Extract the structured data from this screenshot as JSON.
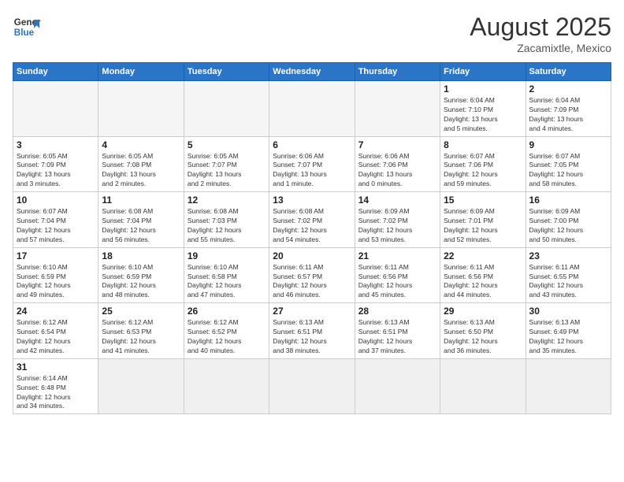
{
  "header": {
    "logo_general": "General",
    "logo_blue": "Blue",
    "month_year": "August 2025",
    "location": "Zacamixtle, Mexico"
  },
  "weekdays": [
    "Sunday",
    "Monday",
    "Tuesday",
    "Wednesday",
    "Thursday",
    "Friday",
    "Saturday"
  ],
  "weeks": [
    [
      {
        "day": "",
        "info": ""
      },
      {
        "day": "",
        "info": ""
      },
      {
        "day": "",
        "info": ""
      },
      {
        "day": "",
        "info": ""
      },
      {
        "day": "",
        "info": ""
      },
      {
        "day": "1",
        "info": "Sunrise: 6:04 AM\nSunset: 7:10 PM\nDaylight: 13 hours\nand 5 minutes."
      },
      {
        "day": "2",
        "info": "Sunrise: 6:04 AM\nSunset: 7:09 PM\nDaylight: 13 hours\nand 4 minutes."
      }
    ],
    [
      {
        "day": "3",
        "info": "Sunrise: 6:05 AM\nSunset: 7:09 PM\nDaylight: 13 hours\nand 3 minutes."
      },
      {
        "day": "4",
        "info": "Sunrise: 6:05 AM\nSunset: 7:08 PM\nDaylight: 13 hours\nand 2 minutes."
      },
      {
        "day": "5",
        "info": "Sunrise: 6:05 AM\nSunset: 7:07 PM\nDaylight: 13 hours\nand 2 minutes."
      },
      {
        "day": "6",
        "info": "Sunrise: 6:06 AM\nSunset: 7:07 PM\nDaylight: 13 hours\nand 1 minute."
      },
      {
        "day": "7",
        "info": "Sunrise: 6:06 AM\nSunset: 7:06 PM\nDaylight: 13 hours\nand 0 minutes."
      },
      {
        "day": "8",
        "info": "Sunrise: 6:07 AM\nSunset: 7:06 PM\nDaylight: 12 hours\nand 59 minutes."
      },
      {
        "day": "9",
        "info": "Sunrise: 6:07 AM\nSunset: 7:05 PM\nDaylight: 12 hours\nand 58 minutes."
      }
    ],
    [
      {
        "day": "10",
        "info": "Sunrise: 6:07 AM\nSunset: 7:04 PM\nDaylight: 12 hours\nand 57 minutes."
      },
      {
        "day": "11",
        "info": "Sunrise: 6:08 AM\nSunset: 7:04 PM\nDaylight: 12 hours\nand 56 minutes."
      },
      {
        "day": "12",
        "info": "Sunrise: 6:08 AM\nSunset: 7:03 PM\nDaylight: 12 hours\nand 55 minutes."
      },
      {
        "day": "13",
        "info": "Sunrise: 6:08 AM\nSunset: 7:02 PM\nDaylight: 12 hours\nand 54 minutes."
      },
      {
        "day": "14",
        "info": "Sunrise: 6:09 AM\nSunset: 7:02 PM\nDaylight: 12 hours\nand 53 minutes."
      },
      {
        "day": "15",
        "info": "Sunrise: 6:09 AM\nSunset: 7:01 PM\nDaylight: 12 hours\nand 52 minutes."
      },
      {
        "day": "16",
        "info": "Sunrise: 6:09 AM\nSunset: 7:00 PM\nDaylight: 12 hours\nand 50 minutes."
      }
    ],
    [
      {
        "day": "17",
        "info": "Sunrise: 6:10 AM\nSunset: 6:59 PM\nDaylight: 12 hours\nand 49 minutes."
      },
      {
        "day": "18",
        "info": "Sunrise: 6:10 AM\nSunset: 6:59 PM\nDaylight: 12 hours\nand 48 minutes."
      },
      {
        "day": "19",
        "info": "Sunrise: 6:10 AM\nSunset: 6:58 PM\nDaylight: 12 hours\nand 47 minutes."
      },
      {
        "day": "20",
        "info": "Sunrise: 6:11 AM\nSunset: 6:57 PM\nDaylight: 12 hours\nand 46 minutes."
      },
      {
        "day": "21",
        "info": "Sunrise: 6:11 AM\nSunset: 6:56 PM\nDaylight: 12 hours\nand 45 minutes."
      },
      {
        "day": "22",
        "info": "Sunrise: 6:11 AM\nSunset: 6:56 PM\nDaylight: 12 hours\nand 44 minutes."
      },
      {
        "day": "23",
        "info": "Sunrise: 6:11 AM\nSunset: 6:55 PM\nDaylight: 12 hours\nand 43 minutes."
      }
    ],
    [
      {
        "day": "24",
        "info": "Sunrise: 6:12 AM\nSunset: 6:54 PM\nDaylight: 12 hours\nand 42 minutes."
      },
      {
        "day": "25",
        "info": "Sunrise: 6:12 AM\nSunset: 6:53 PM\nDaylight: 12 hours\nand 41 minutes."
      },
      {
        "day": "26",
        "info": "Sunrise: 6:12 AM\nSunset: 6:52 PM\nDaylight: 12 hours\nand 40 minutes."
      },
      {
        "day": "27",
        "info": "Sunrise: 6:13 AM\nSunset: 6:51 PM\nDaylight: 12 hours\nand 38 minutes."
      },
      {
        "day": "28",
        "info": "Sunrise: 6:13 AM\nSunset: 6:51 PM\nDaylight: 12 hours\nand 37 minutes."
      },
      {
        "day": "29",
        "info": "Sunrise: 6:13 AM\nSunset: 6:50 PM\nDaylight: 12 hours\nand 36 minutes."
      },
      {
        "day": "30",
        "info": "Sunrise: 6:13 AM\nSunset: 6:49 PM\nDaylight: 12 hours\nand 35 minutes."
      }
    ],
    [
      {
        "day": "31",
        "info": "Sunrise: 6:14 AM\nSunset: 6:48 PM\nDaylight: 12 hours\nand 34 minutes."
      },
      {
        "day": "",
        "info": ""
      },
      {
        "day": "",
        "info": ""
      },
      {
        "day": "",
        "info": ""
      },
      {
        "day": "",
        "info": ""
      },
      {
        "day": "",
        "info": ""
      },
      {
        "day": "",
        "info": ""
      }
    ]
  ]
}
